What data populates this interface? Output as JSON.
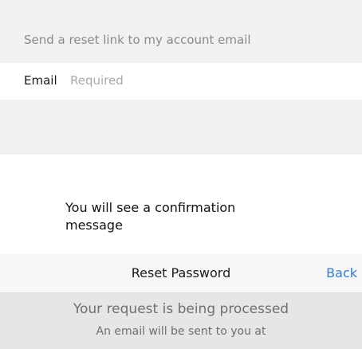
{
  "reset_form": {
    "hint": "Send a reset link to my account email",
    "email_label": "Email",
    "email_placeholder": "Required",
    "email_value": ""
  },
  "caption": "You will see a confirmation message",
  "nav": {
    "title": "Reset Password",
    "back_label": "Back"
  },
  "status": {
    "title": "Your request is being processed",
    "body": "An email will be sent to you at"
  },
  "colors": {
    "accent": "#2f7ed8",
    "section_background": "#f1f1f1"
  }
}
